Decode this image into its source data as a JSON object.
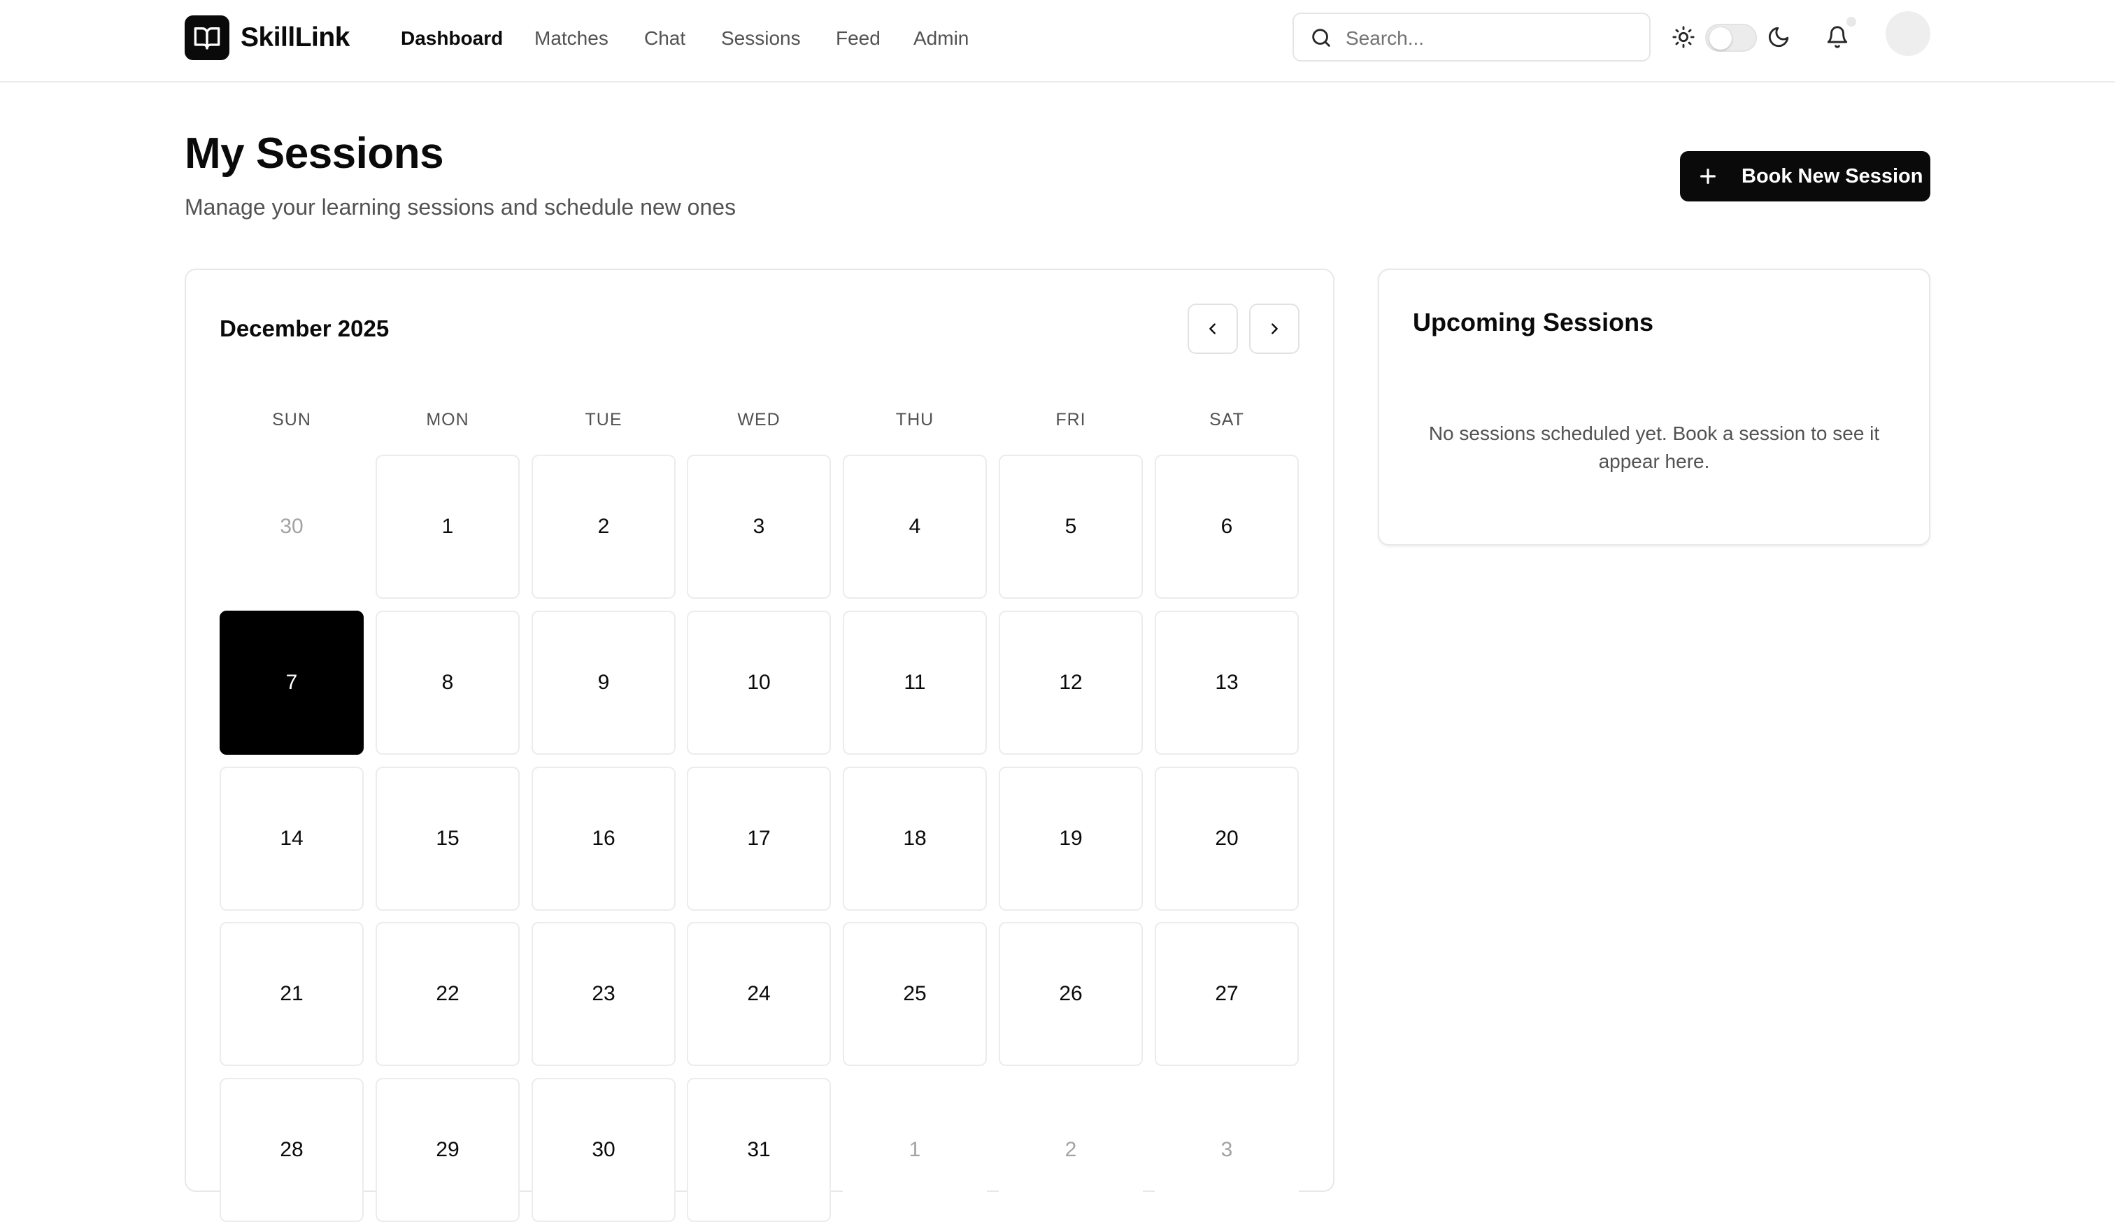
{
  "app": {
    "name": "SkillLink"
  },
  "nav": {
    "items": [
      {
        "label": "Dashboard",
        "active": true
      },
      {
        "label": "Matches",
        "active": false
      },
      {
        "label": "Chat",
        "active": false
      },
      {
        "label": "Sessions",
        "active": false
      },
      {
        "label": "Feed",
        "active": false
      },
      {
        "label": "Admin",
        "active": false
      }
    ]
  },
  "search": {
    "placeholder": "Search...",
    "value": ""
  },
  "theme": {
    "mode": "light",
    "icons": [
      "sun-icon",
      "moon-icon"
    ]
  },
  "notifications": {
    "icon": "bell-icon"
  },
  "header": {
    "title": "My Sessions",
    "subtitle": "Manage your learning sessions and schedule new ones",
    "book_button": "Book New Session"
  },
  "calendar": {
    "month_label": "December 2025",
    "weekdays": [
      "SUN",
      "MON",
      "TUE",
      "WED",
      "THU",
      "FRI",
      "SAT"
    ],
    "weeks": [
      [
        {
          "d": "30",
          "m": true
        },
        {
          "d": "1"
        },
        {
          "d": "2"
        },
        {
          "d": "3"
        },
        {
          "d": "4"
        },
        {
          "d": "5"
        },
        {
          "d": "6"
        }
      ],
      [
        {
          "d": "7",
          "today": true
        },
        {
          "d": "8"
        },
        {
          "d": "9"
        },
        {
          "d": "10"
        },
        {
          "d": "11"
        },
        {
          "d": "12"
        },
        {
          "d": "13"
        }
      ],
      [
        {
          "d": "14"
        },
        {
          "d": "15"
        },
        {
          "d": "16"
        },
        {
          "d": "17"
        },
        {
          "d": "18"
        },
        {
          "d": "19"
        },
        {
          "d": "20"
        }
      ],
      [
        {
          "d": "21"
        },
        {
          "d": "22"
        },
        {
          "d": "23"
        },
        {
          "d": "24"
        },
        {
          "d": "25"
        },
        {
          "d": "26"
        },
        {
          "d": "27"
        }
      ],
      [
        {
          "d": "28"
        },
        {
          "d": "29"
        },
        {
          "d": "30"
        },
        {
          "d": "31"
        },
        {
          "d": "1",
          "m": true
        },
        {
          "d": "2",
          "m": true
        },
        {
          "d": "3",
          "m": true
        }
      ]
    ]
  },
  "upcoming": {
    "title": "Upcoming Sessions",
    "empty_text": "No sessions scheduled yet. Book a session to see it appear here."
  },
  "colors": {
    "accent": "#0a0a0a",
    "muted_text": "#525252",
    "border": "#e8e8e8",
    "today_bg": "#000000"
  }
}
